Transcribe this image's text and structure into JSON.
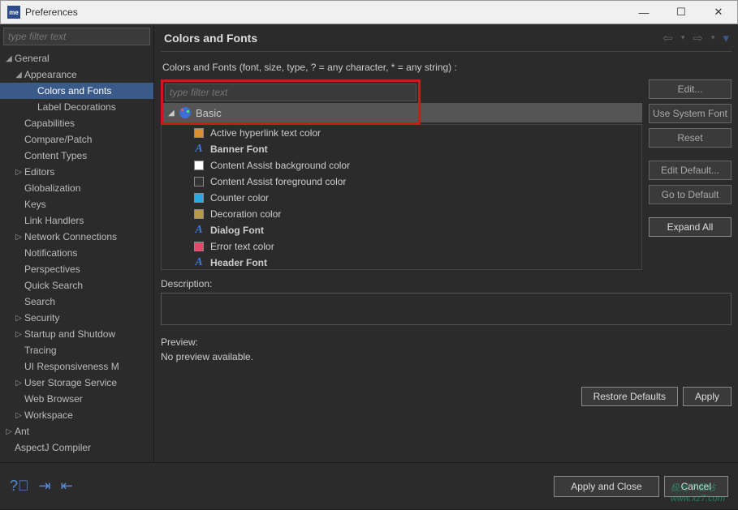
{
  "window": {
    "title": "Preferences"
  },
  "sidebar": {
    "filter_placeholder": "type filter text",
    "items": [
      {
        "label": "General",
        "arrow": "◢",
        "indent": 0
      },
      {
        "label": "Appearance",
        "arrow": "◢",
        "indent": 1
      },
      {
        "label": "Colors and Fonts",
        "arrow": "",
        "indent": 2,
        "selected": true
      },
      {
        "label": "Label Decorations",
        "arrow": "",
        "indent": 2
      },
      {
        "label": "Capabilities",
        "arrow": "",
        "indent": 1
      },
      {
        "label": "Compare/Patch",
        "arrow": "",
        "indent": 1
      },
      {
        "label": "Content Types",
        "arrow": "",
        "indent": 1
      },
      {
        "label": "Editors",
        "arrow": "▷",
        "indent": 1
      },
      {
        "label": "Globalization",
        "arrow": "",
        "indent": 1
      },
      {
        "label": "Keys",
        "arrow": "",
        "indent": 1
      },
      {
        "label": "Link Handlers",
        "arrow": "",
        "indent": 1
      },
      {
        "label": "Network Connections",
        "arrow": "▷",
        "indent": 1
      },
      {
        "label": "Notifications",
        "arrow": "",
        "indent": 1
      },
      {
        "label": "Perspectives",
        "arrow": "",
        "indent": 1
      },
      {
        "label": "Quick Search",
        "arrow": "",
        "indent": 1
      },
      {
        "label": "Search",
        "arrow": "",
        "indent": 1
      },
      {
        "label": "Security",
        "arrow": "▷",
        "indent": 1
      },
      {
        "label": "Startup and Shutdow",
        "arrow": "▷",
        "indent": 1
      },
      {
        "label": "Tracing",
        "arrow": "",
        "indent": 1
      },
      {
        "label": "UI Responsiveness M",
        "arrow": "",
        "indent": 1
      },
      {
        "label": "User Storage Service",
        "arrow": "▷",
        "indent": 1
      },
      {
        "label": "Web Browser",
        "arrow": "",
        "indent": 1
      },
      {
        "label": "Workspace",
        "arrow": "▷",
        "indent": 1
      },
      {
        "label": "Ant",
        "arrow": "▷",
        "indent": 0
      },
      {
        "label": "AspectJ Compiler",
        "arrow": "",
        "indent": 0
      }
    ]
  },
  "page": {
    "title": "Colors and Fonts",
    "hint": "Colors and Fonts (font, size, type, ? = any character, * = any string) :",
    "inner_filter_placeholder": "type filter text",
    "basic_label": "Basic",
    "items": [
      {
        "label": "Active hyperlink text color",
        "kind": "color",
        "swatch": "#d89030"
      },
      {
        "label": "Banner Font",
        "kind": "font",
        "bold": true
      },
      {
        "label": "Content Assist background color",
        "kind": "color",
        "swatch": "#ffffff"
      },
      {
        "label": "Content Assist foreground color",
        "kind": "color",
        "swatch": "#333333"
      },
      {
        "label": "Counter color",
        "kind": "color",
        "swatch": "#2aa8e0"
      },
      {
        "label": "Decoration color",
        "kind": "color",
        "swatch": "#b89a4a"
      },
      {
        "label": "Dialog Font",
        "kind": "font",
        "bold": true
      },
      {
        "label": "Error text color",
        "kind": "color",
        "swatch": "#e04a6a"
      },
      {
        "label": "Header Font",
        "kind": "font",
        "bold": true
      }
    ],
    "buttons": {
      "edit": "Edit...",
      "use_system": "Use System Font",
      "reset": "Reset",
      "edit_default": "Edit Default...",
      "go_default": "Go to Default",
      "expand_all": "Expand All"
    },
    "description_label": "Description:",
    "preview_label": "Preview:",
    "preview_text": "No preview available.",
    "restore_defaults": "Restore Defaults",
    "apply": "Apply"
  },
  "footer": {
    "apply_close": "Apply and Close",
    "cancel": "Cancel"
  }
}
